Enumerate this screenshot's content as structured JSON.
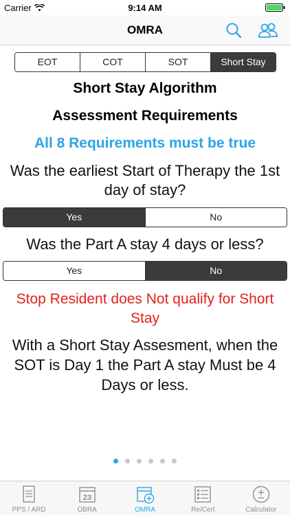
{
  "status_bar": {
    "carrier": "Carrier",
    "time": "9:14 AM"
  },
  "nav": {
    "title": "OMRA"
  },
  "segments": [
    {
      "label": "EOT",
      "active": false
    },
    {
      "label": "COT",
      "active": false
    },
    {
      "label": "SOT",
      "active": false
    },
    {
      "label": "Short Stay",
      "active": true
    }
  ],
  "content": {
    "heading1": "Short Stay Algorithm",
    "heading2": "Assessment Requirements",
    "requirement_note": "All 8 Requirements must be true",
    "question1": "Was the earliest Start of Therapy the 1st day of stay?",
    "question1_yes": "Yes",
    "question1_no": "No",
    "question1_selected": "Yes",
    "question2": "Was the Part A stay 4 days or less?",
    "question2_yes": "Yes",
    "question2_no": "No",
    "question2_selected": "No",
    "stop_message": "Stop Resident does Not qualify for Short Stay",
    "info_message": "With a Short Stay Assesment, when the SOT is Day 1 the Part A stay Must be 4 Days or less."
  },
  "page_indicator": {
    "count": 6,
    "current": 1
  },
  "tabs": [
    {
      "label": "PPS / ARD",
      "icon": "list-document-icon",
      "active": false
    },
    {
      "label": "OBRA",
      "icon": "calendar-icon",
      "active": false,
      "badge": "23"
    },
    {
      "label": "OMRA",
      "icon": "calendar-add-icon",
      "active": true
    },
    {
      "label": "Re/Cert",
      "icon": "checklist-icon",
      "active": false
    },
    {
      "label": "Calculator",
      "icon": "plus-minus-icon",
      "active": false
    }
  ],
  "colors": {
    "accent": "#2aa6e8",
    "alert": "#e3201c",
    "selected_segment": "#3b3b3b"
  }
}
